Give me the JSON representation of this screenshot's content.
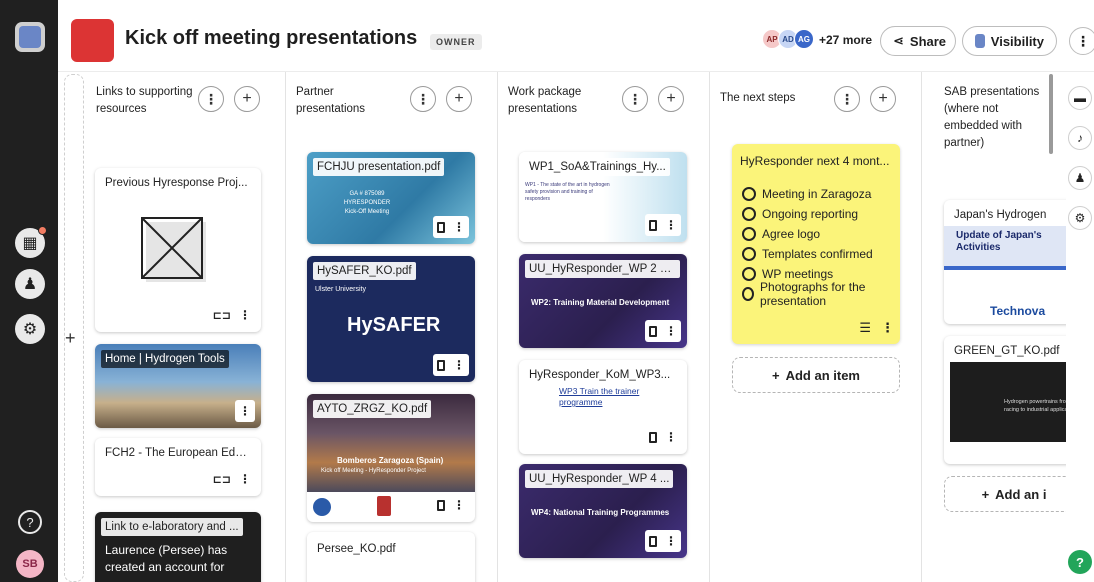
{
  "board": {
    "title": "Kick off meeting presentations",
    "role_badge": "OWNER",
    "collaborators": [
      "AP",
      "AD",
      "AG"
    ],
    "more_collaborators": "+27 more",
    "share_label": "Share",
    "visibility_label": "Visibility",
    "accent_color": "#dc3434",
    "more_icon": "⋮"
  },
  "rail": {
    "avatar_initials": "SB",
    "help_glyph": "?"
  },
  "columns": [
    {
      "title": "Links to supporting resources",
      "cards": [
        {
          "label": "Previous Hyresponse Proj..."
        },
        {
          "label": "Home | Hydrogen Tools"
        },
        {
          "label": "FCH2 - The European Edu..."
        },
        {
          "label": "Link to e-laboratory and ...",
          "body": "Laurence (Persee) has created an account for"
        }
      ]
    },
    {
      "title": "Partner presentations",
      "cards": [
        {
          "label": "FCHJU presentation.pdf",
          "thumb_lines": [
            "GA # 875089",
            "HYRESPONDER",
            "Kick-Off Meeting"
          ]
        },
        {
          "label": "HySAFER_KO.pdf",
          "thumb_big": "HySAFER",
          "thumb_small": "Ulster University"
        },
        {
          "label": "AYTO_ZRGZ_KO.pdf",
          "thumb_big": "Bomberos Zaragoza (Spain)",
          "thumb_small": "Kick off Meeting - HyResponder Project"
        },
        {
          "label": "Persee_KO.pdf"
        }
      ]
    },
    {
      "title": "Work package presentations",
      "cards": [
        {
          "label": "WP1_SoA&Trainings_Hy...",
          "thumb_small": "WP1 - The state of the art in hydrogen safety provision and training of responders"
        },
        {
          "label": "UU_HyResponder_WP 2 2...",
          "thumb_big": "WP2: Training Material Development"
        },
        {
          "label": "HyResponder_KoM_WP3...",
          "thumb_big": "WP3 Train the trainer programme"
        },
        {
          "label": "UU_HyResponder_WP 4 ...",
          "thumb_big": "WP4: National Training Programmes"
        }
      ]
    },
    {
      "title": "The next steps",
      "note": {
        "title": "HyResponder next 4 mont...",
        "items": [
          "Meeting in Zaragoza",
          "Ongoing reporting",
          "Agree logo",
          "Templates confirmed",
          "WP meetings",
          "Photographs for the presentation"
        ]
      },
      "add_item": "Add an item"
    },
    {
      "title": "SAB presentations (where not embedded with partner)",
      "cards": [
        {
          "label": "Japan's Hydrogen",
          "thumb_big": "Update of Japan's Activities",
          "thumb_small": "Technova"
        },
        {
          "label": "GREEN_GT_KO.pdf",
          "thumb_small": "Hydrogen powertrains from racing to industrial applications"
        }
      ],
      "add_item": "Add an i"
    }
  ]
}
